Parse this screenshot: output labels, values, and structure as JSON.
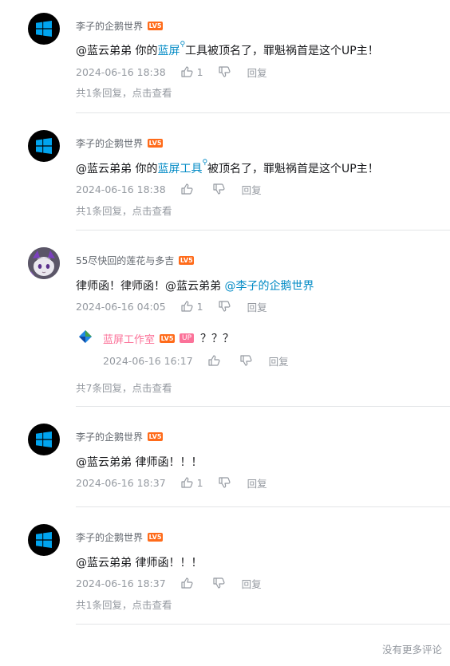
{
  "comments": [
    {
      "username": "李子的企鹅世界",
      "level": "LV5",
      "content_prefix": "@蓝云弟弟 你的",
      "content_link": "蓝屏",
      "content_suffix": "工具被顶名了，罪魁祸首是这个UP主！",
      "time": "2024-06-16 18:38",
      "likes": "1",
      "reply_label": "回复",
      "more_replies": "共1条回复，点击查看"
    },
    {
      "username": "李子的企鹅世界",
      "level": "LV5",
      "content_prefix": "@蓝云弟弟 你的",
      "content_link": "蓝屏工具",
      "content_suffix": "被顶名了，罪魁祸首是这个UP主！",
      "time": "2024-06-16 18:38",
      "likes": "",
      "reply_label": "回复",
      "more_replies": "共1条回复，点击查看"
    },
    {
      "username": "55尽快回的莲花与多吉",
      "level": "LV5",
      "content_prefix": "律师函！律师函！@蓝云弟弟 ",
      "content_link": "@李子的企鹅世界",
      "content_suffix": "",
      "time": "2024-06-16 04:05",
      "likes": "1",
      "reply_label": "回复",
      "sub_reply": {
        "username": "蓝屏工作室",
        "level": "LV5",
        "badge": "UP",
        "text": "？？？",
        "time": "2024-06-16 16:17",
        "reply_label": "回复"
      },
      "more_replies": "共7条回复，点击查看"
    },
    {
      "username": "李子的企鹅世界",
      "level": "LV5",
      "content_prefix": "@蓝云弟弟 律师函！！！",
      "time": "2024-06-16 18:37",
      "likes": "1",
      "reply_label": "回复"
    },
    {
      "username": "李子的企鹅世界",
      "level": "LV5",
      "content_prefix": "@蓝云弟弟 律师函！！！",
      "time": "2024-06-16 18:37",
      "likes": "",
      "reply_label": "回复",
      "more_replies": "共1条回复，点击查看"
    }
  ],
  "footer": "没有更多评论",
  "colors": {
    "link": "#008ac5",
    "level_badge": "#ff6b1a",
    "up_badge": "#fb7299",
    "meta_text": "#9499a0"
  }
}
